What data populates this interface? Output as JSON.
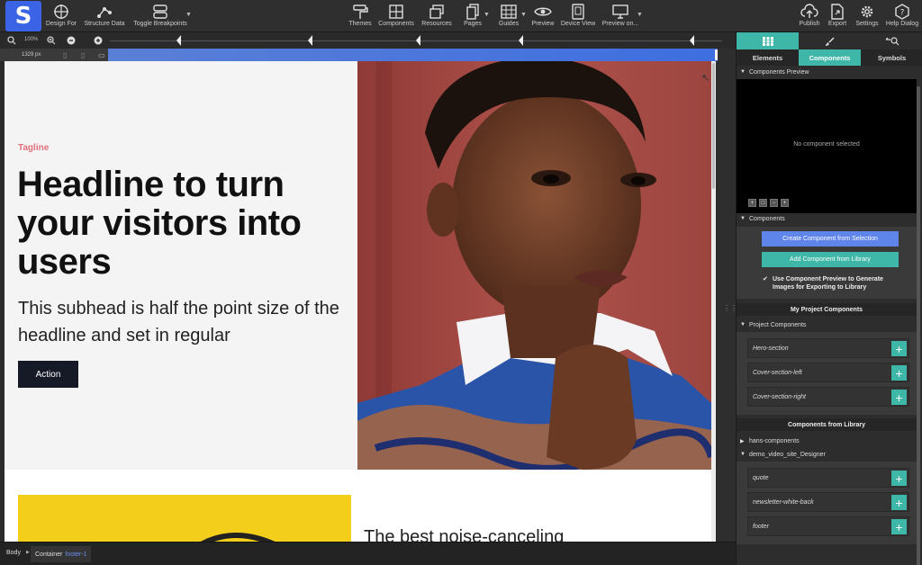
{
  "toolbar": {
    "design_for": "Design For",
    "structure_data": "Structure Data",
    "toggle_breakpoints": "Toggle Breakpoints",
    "themes": "Themes",
    "components": "Components",
    "resources": "Resources",
    "pages": "Pages",
    "guides": "Guides",
    "preview": "Preview",
    "device_view": "Device View",
    "preview_on": "Preview on...",
    "publish": "Publish",
    "export": "Export",
    "settings": "Settings",
    "help_dialog": "Help Dialog"
  },
  "zoom": {
    "level": "100%"
  },
  "ruler": {
    "width_px": "1329 px"
  },
  "canvas": {
    "tagline": "Tagline",
    "headline": "Headline to turn your visitors into users",
    "subhead": "This subhead is half the point size of the headline and set in regular",
    "action": "Action",
    "section2_text": "The best noise-canceling"
  },
  "statusbar": {
    "body": "Body",
    "container": "Container",
    "footer": "footer-1"
  },
  "panel": {
    "subtabs": [
      "Elements",
      "Components",
      "Symbols"
    ],
    "preview_title": "Components Preview",
    "no_component": "No component selected",
    "components_title": "Components",
    "create_btn": "Create Component from Selection",
    "add_btn": "Add Component from Library",
    "checkbox_label": "Use Component Preview to Generate Images for Exporting to Library",
    "my_project": "My Project Components",
    "project_components": "Project Components",
    "project_items": [
      "Hero-section",
      "Cover-section-left",
      "Cover-section-right"
    ],
    "from_library": "Components from Library",
    "lib_hans": "hans-components",
    "lib_demo": "demo_video_site_Designer",
    "library_items": [
      "quote",
      "newsletter-white-back",
      "footer"
    ]
  },
  "colors": {
    "accent_teal": "#3fb7a8",
    "accent_blue": "#5f84ea",
    "logo_blue": "#3b63e6",
    "tagline": "#e0707a"
  }
}
